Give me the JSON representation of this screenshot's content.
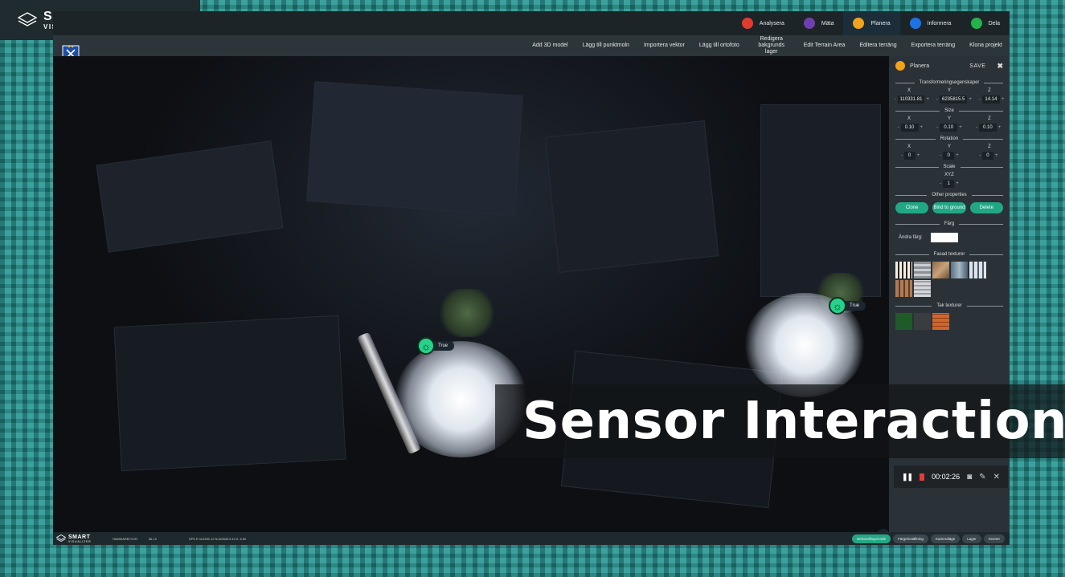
{
  "brand": {
    "name": "SMART",
    "sub": "VISUALIZER"
  },
  "mode_tabs": [
    {
      "label": "Analysera",
      "color": "#e23b2e",
      "icon": "analyze-icon"
    },
    {
      "label": "Mäta",
      "color": "#6f3fb0",
      "icon": "measure-icon"
    },
    {
      "label": "Planera",
      "color": "#f0a31b",
      "icon": "plan-icon",
      "active": true
    },
    {
      "label": "Informera",
      "color": "#1e72e8",
      "icon": "inform-icon"
    },
    {
      "label": "Dela",
      "color": "#22b34a",
      "icon": "share-icon"
    }
  ],
  "toolbar": [
    "Add 3D model",
    "Lägg till punktmoln",
    "Importera vektor",
    "Lägg till ortofoto",
    "Redigera bakgrunds lager",
    "Edit Terrain Area",
    "Editera terräng",
    "Exportera terräng",
    "Klona projekt"
  ],
  "sensors": [
    {
      "label": "True",
      "icon": "sensor-icon"
    },
    {
      "label": "True",
      "icon": "sensor-icon"
    }
  ],
  "viewport_controls": {
    "help": "?",
    "mode": "2D",
    "compass": "compass-icon"
  },
  "panel": {
    "title": "Planera",
    "save": "SAVE",
    "close": "✖",
    "transform_title": "Transformeringsegenskaper",
    "axes_xyz": [
      "X",
      "Y",
      "Z"
    ],
    "position": [
      "110331.81",
      "6235815.5",
      "14.14"
    ],
    "size_title": "Size",
    "size": [
      "0.10",
      "0.10",
      "0.10"
    ],
    "rotation_title": "Rotation",
    "rotation": [
      "0",
      "0",
      "0"
    ],
    "scale_title": "Scale",
    "scale_axis": "XYZ",
    "scale": "1",
    "other_title": "Other properties",
    "buttons": [
      "Clone",
      "Bind to ground",
      "Delete"
    ],
    "color_title": "Färg",
    "color_label": "Ändra färg:",
    "color_value": "#ffffff",
    "facade_title": "Fasad texturer",
    "roof_title": "Tak texturer"
  },
  "recorder": {
    "time": "00:02:26"
  },
  "statusbar": {
    "logo": "SMART",
    "logo_sub": "VISUALIZER",
    "items": [
      "HAMMARBYSJÖ",
      "56.12",
      "SPS E:110330.12 N:6235813.43 Z: 6.60"
    ],
    "tabs": [
      "Behandlingsmode",
      "Färgeinställning",
      "Kameraläge",
      "Lager",
      "Scener"
    ]
  },
  "caption": "Sensor Interaction"
}
